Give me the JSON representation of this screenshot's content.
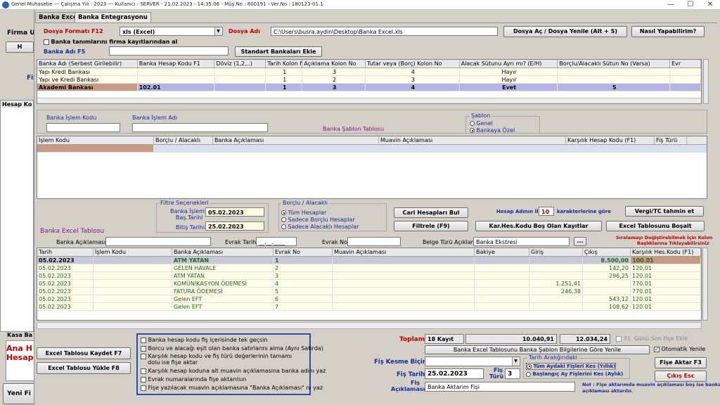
{
  "window": {
    "title": "Genel Muhasebe  ---  Çalışma Yılı : 2023  ---  Kullanıcı : SERVER - 21.02.2023 - 14:35:06 - Müş.No : 800191 - Ver.No : 180123-01.1",
    "minimize": "—",
    "maximize": "☐",
    "close": "✕"
  },
  "background": {
    "firma_label": "Firma U",
    "h_label": "H",
    "fis_label": "Fiş",
    "hesap_kod_label": "Hesap Ko",
    "kasa_label": "Kasa Ba",
    "ana_label": "Ana H",
    "hesap_label": "Hesap",
    "yeni_label": "Yeni Fi"
  },
  "tabs": [
    {
      "label": "Banka Excel"
    },
    {
      "label": "Banka Entegrasyonu"
    }
  ],
  "top": {
    "dosya_formati_label": "Dosya Formatı F12",
    "dosya_formati_value": "xls (Excel)",
    "dosya_adi_label": "Dosya Adı",
    "dosya_adi_value": "C:\\Users\\busra.aydin\\Desktop\\Banka Excel.xls",
    "dosya_ac_button": "Dosya Aç / Dosya Yenile (Alt + S)",
    "nasil_button": "Nasıl Yapabilirim?",
    "banka_tanimlari_check": "Banka tanımlarını firma kayıtlarından al",
    "banka_adi_label": "Banka Adı F5",
    "standart_button": "Standart Bankaları Ekle"
  },
  "bank_grid": {
    "columns": [
      "Banka Adı (Serbest Girilebilir)",
      "Banka Hesap Kodu F1",
      "Döviz (1,2,..)",
      "Tarih Kolon No",
      "Açıklama Kolon No",
      "Tutar veya (Borç) Kolon No",
      "Alacak Sütunu Ayrı mı? (E/H)",
      "Borçlu/Alacaklı Sütun No (Varsa)",
      "Evr"
    ],
    "rows": [
      [
        "Yapı Kredi Bankası",
        "",
        "",
        "1",
        "3",
        "4",
        "Hayır",
        "",
        ""
      ],
      [
        "Yapı ve Kredi Bankası",
        "",
        "",
        "1",
        "2",
        "3",
        "Hayır",
        "",
        ""
      ],
      [
        "Akademi Bankası",
        "102.01",
        "",
        "1",
        "3",
        "4",
        "Evet",
        "5",
        ""
      ]
    ]
  },
  "islem": {
    "kodu_label": "Banka İşlem Kodu",
    "adi_label": "Banka İşlem Adı",
    "sablon_tablosu_label": "Banka Şablon Tablosu",
    "sablon_legend": "Şablon",
    "sablon_genel": "Genel",
    "sablon_bankaya_ozel": "Bankaya Özel",
    "columns": [
      "İşlem Kodu",
      "Borçlu / Alacaklı",
      "Banka Açıklaması",
      "Muavin Açıklaması",
      "Karşılık Hesap Kodu (F1)",
      "Fiş Türü"
    ]
  },
  "filtre": {
    "legend": "Filtre Seçenekleri",
    "bas_tarih_label1": "Banka İşlem",
    "bas_tarih_label2": "Baş.Tarihi",
    "bas_tarih_value": "05.02.2023",
    "bitis_label": "Bitiş Tarihi",
    "bitis_value": "25.02.2023",
    "borclu_legend": "Borçlu / Alacaklı",
    "tum": "Tüm Hesaplar",
    "borclu": "Sadece Borçlu Hesaplar",
    "alacakli": "Sadece Alacaklı Hesaplar",
    "cari_button": "Cari Hesapları Bul",
    "filtrele_button": "Filtrele (F9)",
    "hesap_adinin_label": "Hesap Adının İlk",
    "hesap_adinin_value": "10",
    "karakter_label": "karakterlerine göre",
    "karhes_button": "Kar.Hes.Kodu Boş Olan Kayıtlar",
    "vergi_button": "Vergi/TC tahmin et",
    "bosalt_button": "Excel Tablosunu Boşalt"
  },
  "excel": {
    "tablo_label": "Banka Excel Tablosu",
    "banka_aciklamasi_label": "Banka Açıklaması",
    "evrak_tarihi_label": "Evrak Tarihi",
    "evrak_tarihi_value": "__.__.____",
    "evrak_no_label": "Evrak No",
    "belge_turu_label": "Belge Türü Açıklaması",
    "belge_turu_value": "Banka Ekstresi",
    "dots": "...",
    "siralama_note1": "Sıralamayı Değiştirebilmek İçin Kolon",
    "siralama_note2": "Başlıklarına Tıklayabilirsiniz",
    "columns": [
      "Tarih",
      "İşlem Kodu",
      "Banka Açıklaması",
      "Evrak No",
      "Muavin Açıklaması",
      "Bakiye",
      "Giriş",
      "Çıkış",
      "Karşılık Hes.Kodu (F1)"
    ],
    "rows": [
      [
        "05.02.2023",
        "",
        "ATM YATAN",
        "1",
        "",
        "",
        "",
        "8.500,00",
        "100.01"
      ],
      [
        "05.02.2023",
        "",
        "GELEN HAVALE",
        "2",
        "",
        "",
        "",
        "142,20",
        "120.01"
      ],
      [
        "05.02.2023",
        "",
        "ATM YATAN",
        "3",
        "",
        "",
        "",
        "296,25",
        "120.01"
      ],
      [
        "05.02.2023",
        "",
        "KOMÜNİKASYON ÖDEMESİ",
        "4",
        "",
        "",
        "1.251,41",
        "",
        "770.01"
      ],
      [
        "05.02.2023",
        "",
        "FATURA ÖDEMESİ",
        "5",
        "",
        "",
        "246,38",
        "",
        "770.01"
      ],
      [
        "05.02.2023",
        "",
        "Gelen EFT",
        "6",
        "",
        "",
        "",
        "543,12",
        "120.01"
      ],
      [
        "05.02.2023",
        "",
        "Gelen EFT",
        "7",
        "",
        "",
        "",
        "108,62",
        "120.01"
      ]
    ]
  },
  "bottom": {
    "kaydet_button": "Excel Tablosu Kaydet F7",
    "yukle_button": "Excel Tablosu Yükle F8",
    "options": [
      "Banka hesap kodu fiş içerisinde tek geçsin",
      "Borcu ve alacağı eşit olan banka satırlarını alma (Aynı Satırda)",
      "Karşılık hesap kodu ve fiş türü değerlerinin tamamı",
      "dolu ise fişe aktar",
      "Karşılık hesap koduna ait muavin açıklamasına banka adını yaz",
      "Evrak numaralarında fişe aktarılsın",
      "Fişe yazılacak muavin açıklamasına \"Banka Açıklaması\" nı yaz"
    ],
    "toplam_label": "Toplam",
    "toplam_kayit": "18 Kayıt",
    "toplam_giris": "10.040,91",
    "toplam_cikis": "12.034,24",
    "gun_son_fis": "31. Günü Son Fişe Ekle",
    "yenile_button": "Banka Excel Tablosunu Banka Şablon Bilgilerine Göre Yenile",
    "otomatik_yenile": "Otomatik Yenile",
    "fis_kesme_label": "Fiş Kesme Biçimi",
    "tarih_araligi_legend": "Tarih Aralığındaki",
    "tum_aydaki": "Tüm Aydaki Fişleri Kes (Yıllık)",
    "baslangic_ay": "Başlangıç Ay Fişlerini Kes (Aylık)",
    "fis_aktar_button": "Fişe Aktar F3",
    "cikis_button": "Çıkış Esc",
    "fis_tarihi_label": "Fiş Tarihi",
    "fis_tarihi_value": "25.02.2023",
    "fis_turu_label1": "Fiş",
    "fis_turu_label2": "Türü",
    "fis_turu_value": "3",
    "fis_aciklama_label1": "Fiş",
    "fis_aciklama_label2": "Açıklaması",
    "fis_aciklama_value": "Banka Aktarım Fişi",
    "note1": "Not : Fişe aktarımda muavin açıklaması boş ise banka",
    "note2": "açıklaması aktarılır."
  }
}
